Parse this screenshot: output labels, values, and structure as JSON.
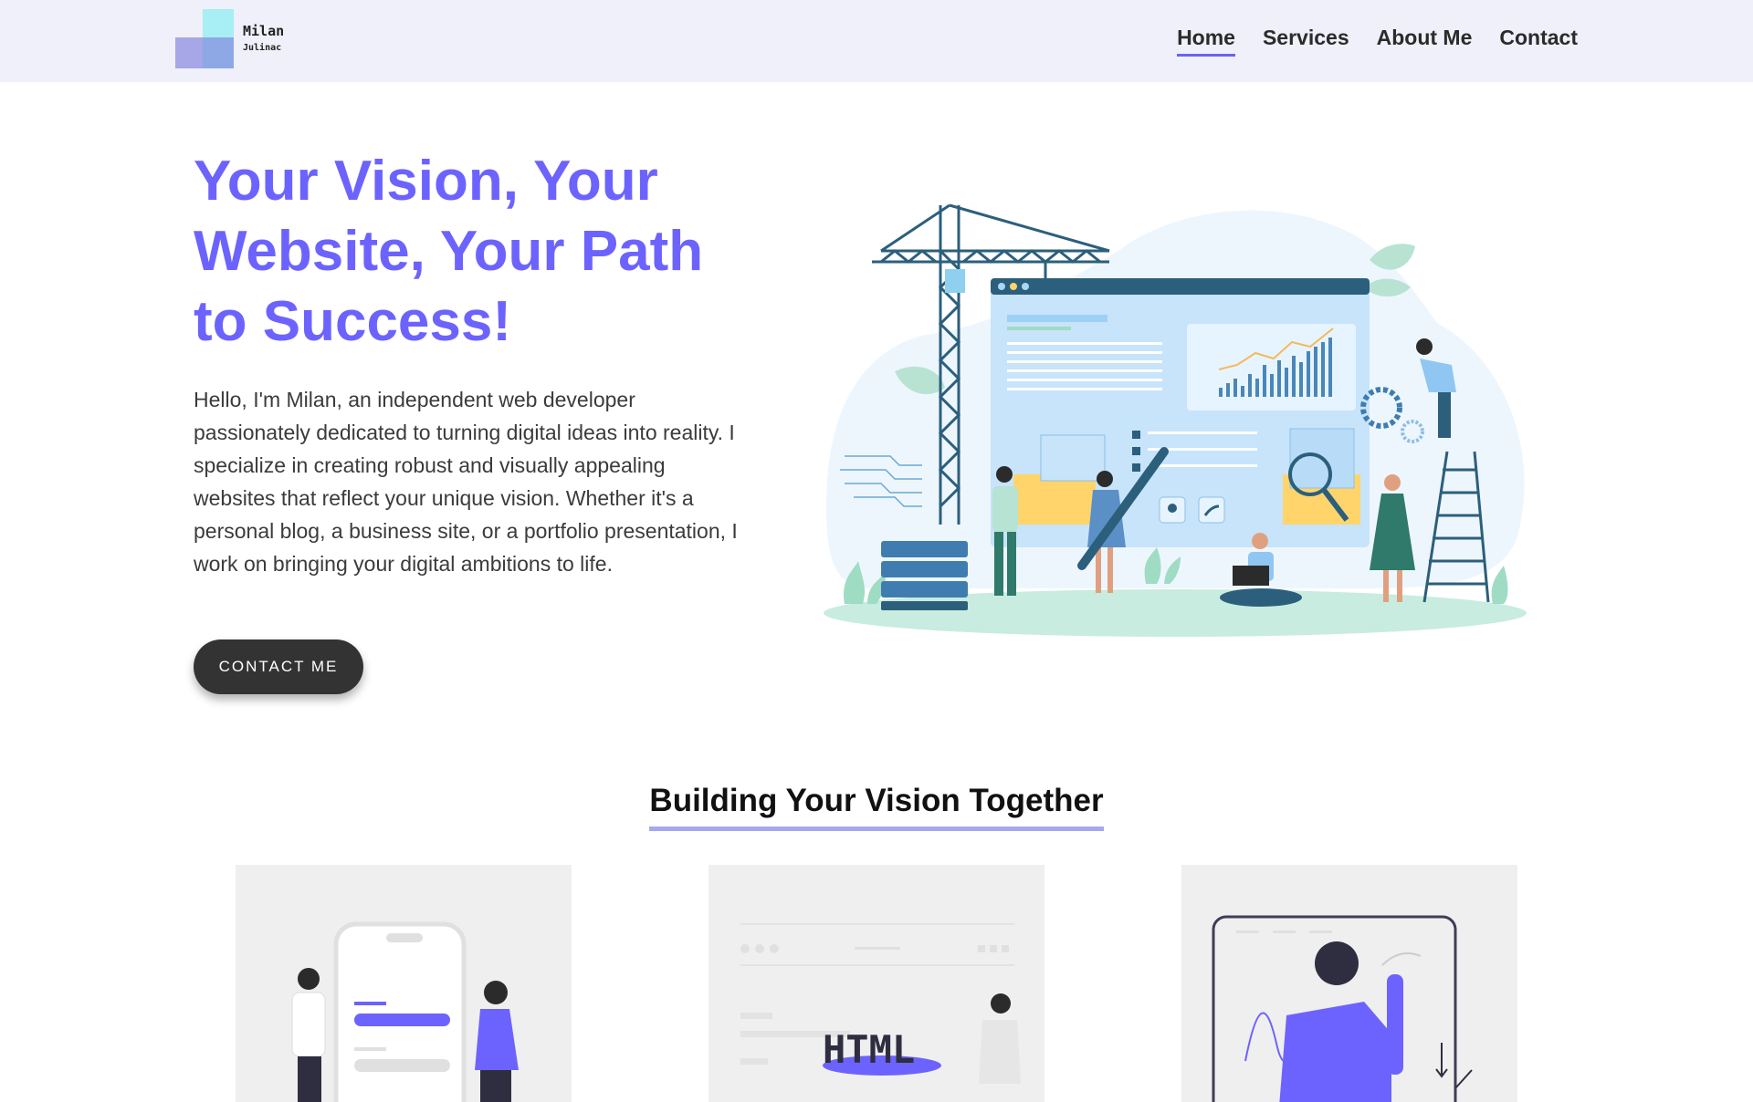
{
  "header": {
    "logo": {
      "name": "Milan",
      "sub": "Julinac"
    },
    "nav": [
      {
        "label": "Home",
        "active": true
      },
      {
        "label": "Services",
        "active": false
      },
      {
        "label": "About Me",
        "active": false
      },
      {
        "label": "Contact",
        "active": false
      }
    ]
  },
  "hero": {
    "title": "Your Vision, Your Website, Your Path to Success!",
    "text": "Hello, I'm Milan, an independent web developer passionately dedicated to turning digital ideas into reality. I specialize in creating robust and visually appealing websites that reflect your unique vision. Whether it's a personal blog, a business site, or a portfolio presentation, I work on bringing your digital ambitions to life.",
    "cta_label": "CONTACT ME"
  },
  "section": {
    "title": "Building Your Vision Together",
    "cards": [
      {
        "illustration": "mobile-app-illustration"
      },
      {
        "illustration": "html-code-illustration"
      },
      {
        "illustration": "analytics-presentation-illustration"
      }
    ]
  },
  "illustration_text": {
    "html_word": "HTML"
  },
  "colors": {
    "accent": "#6c63ff",
    "header_bg": "#eff0f9",
    "button_bg": "#333333",
    "card_bg": "#efefef"
  }
}
